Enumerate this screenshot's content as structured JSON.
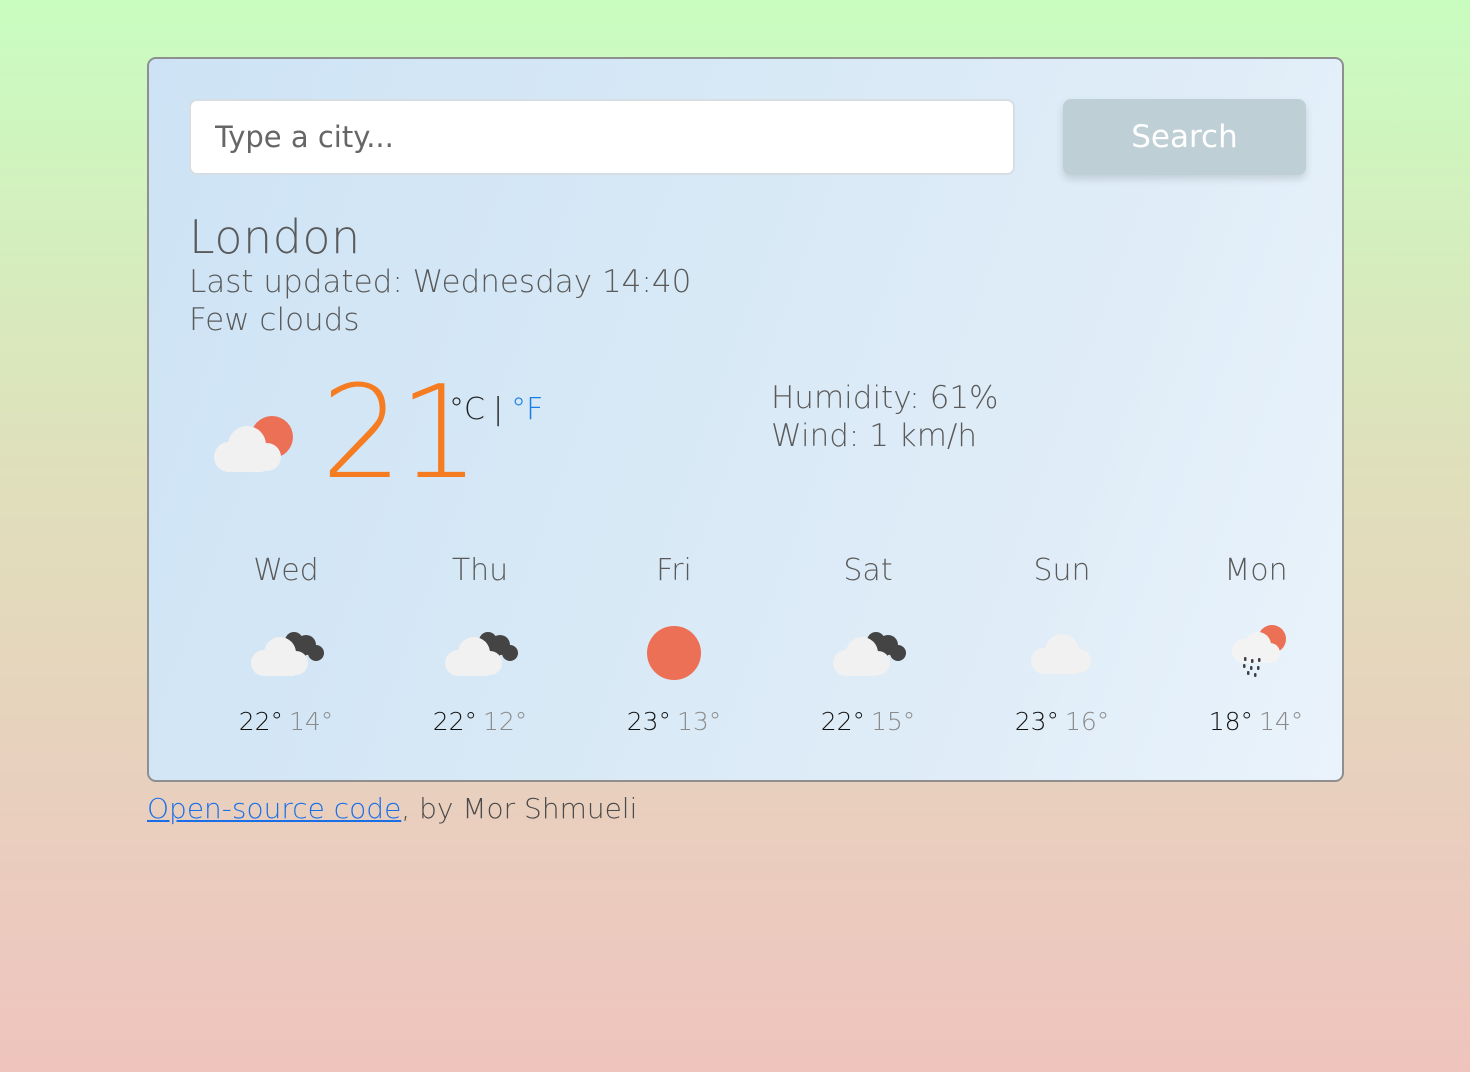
{
  "search": {
    "placeholder": "Type a city...",
    "button_label": "Search"
  },
  "current": {
    "city": "London",
    "last_updated": "Last updated: Wednesday 14:40",
    "description": "Few clouds",
    "icon": "few-clouds-day-icon",
    "temperature": "21",
    "unit_celsius": "°C",
    "unit_separator": "|",
    "unit_fahrenheit": "°F",
    "humidity": "Humidity: 61%",
    "wind": "Wind: 1 km/h"
  },
  "forecast": [
    {
      "day": "Wed",
      "icon": "broken-clouds-icon",
      "max": "22°",
      "min": "14°"
    },
    {
      "day": "Thu",
      "icon": "broken-clouds-icon",
      "max": "22°",
      "min": "12°"
    },
    {
      "day": "Fri",
      "icon": "clear-sky-sun-icon",
      "max": "23°",
      "min": "13°"
    },
    {
      "day": "Sat",
      "icon": "broken-clouds-icon",
      "max": "22°",
      "min": "15°"
    },
    {
      "day": "Sun",
      "icon": "cloud-icon",
      "max": "23°",
      "min": "16°"
    },
    {
      "day": "Mon",
      "icon": "rain-sun-icon",
      "max": "18°",
      "min": "14°"
    }
  ],
  "footer": {
    "link_text": "Open-source code",
    "credit_text": ", by Mor Shmueli"
  },
  "colors": {
    "temperature": "#f57c20",
    "link": "#1a6fe6",
    "sun": "#ec7055",
    "search_button": "#bfcfd6"
  }
}
